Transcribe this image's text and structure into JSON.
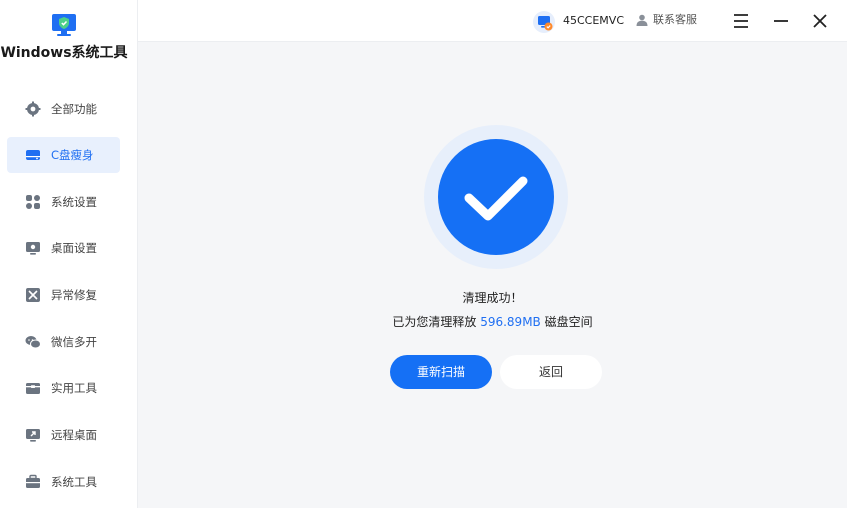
{
  "app": {
    "title": "Windows系统工具",
    "brand_icon": "monitor-shield-icon"
  },
  "sidebar": {
    "items": [
      {
        "label": "全部功能",
        "icon": "gear-icon",
        "active": false
      },
      {
        "label": "C盘瘦身",
        "icon": "drive-icon",
        "active": true
      },
      {
        "label": "系统设置",
        "icon": "grid-icon",
        "active": false
      },
      {
        "label": "桌面设置",
        "icon": "desktop-icon",
        "active": false
      },
      {
        "label": "异常修复",
        "icon": "repair-icon",
        "active": false
      },
      {
        "label": "微信多开",
        "icon": "wechat-icon",
        "active": false
      },
      {
        "label": "实用工具",
        "icon": "toolbox-icon",
        "active": false
      },
      {
        "label": "远程桌面",
        "icon": "remote-desktop-icon",
        "active": false
      },
      {
        "label": "系统工具",
        "icon": "briefcase-icon",
        "active": false
      }
    ]
  },
  "topbar": {
    "user_name": "45CCEMVC",
    "support_label": "联系客服"
  },
  "result": {
    "title": "清理成功！",
    "line_prefix": "已为您清理释放",
    "amount": "596.89MB",
    "line_suffix": "磁盘空间"
  },
  "actions": {
    "rescan_label": "重新扫描",
    "back_label": "返回"
  },
  "colors": {
    "accent": "#1570f5",
    "active_bg": "#e8f0fd",
    "ring": "#e7effb"
  }
}
